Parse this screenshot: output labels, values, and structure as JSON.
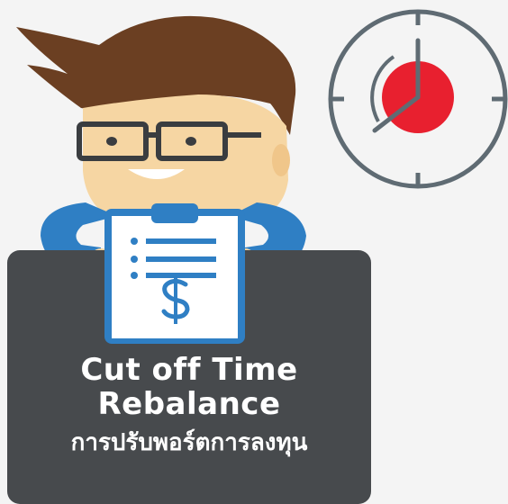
{
  "card": {
    "title_line1": "Cut off Time",
    "title_line2": "Rebalance",
    "subtitle": "การปรับพอร์ตการลงทุน"
  },
  "icons": [
    "clock-icon",
    "character-illustration",
    "clipboard-icon",
    "dollar-sign-icon"
  ],
  "colors": {
    "card_bg": "#474a4d",
    "clock_red": "#e8202f",
    "clock_stroke": "#5f6b73",
    "sleeve_blue": "#2f7fc4",
    "hair": "#6b3f22",
    "skin": "#f6d6a3"
  }
}
